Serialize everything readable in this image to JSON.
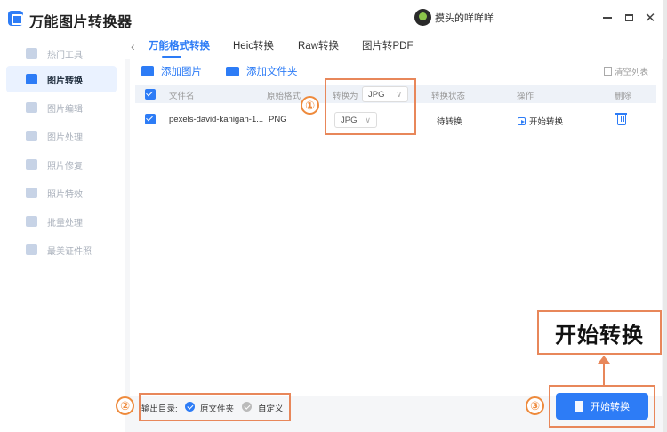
{
  "app": {
    "title": "万能图片转换器",
    "username": "摸头的咩咩咩"
  },
  "sidebar": {
    "items": [
      {
        "label": "热门工具",
        "active": false
      },
      {
        "label": "图片转换",
        "active": true
      },
      {
        "label": "图片编辑",
        "active": false
      },
      {
        "label": "图片处理",
        "active": false
      },
      {
        "label": "照片修复",
        "active": false
      },
      {
        "label": "照片特效",
        "active": false
      },
      {
        "label": "批量处理",
        "active": false
      },
      {
        "label": "最美证件照",
        "active": false
      }
    ]
  },
  "tabs": [
    {
      "label": "万能格式转换",
      "active": true
    },
    {
      "label": "Heic转换",
      "active": false
    },
    {
      "label": "Raw转换",
      "active": false
    },
    {
      "label": "图片转PDF",
      "active": false
    }
  ],
  "toolbar": {
    "add_image": "添加图片",
    "add_folder": "添加文件夹",
    "clear_list": "清空列表"
  },
  "table": {
    "headers": {
      "filename": "文件名",
      "orig_format": "原始格式",
      "convert_to": "转换为",
      "status": "转换状态",
      "action": "操作",
      "delete": "删除"
    },
    "header_convert_value": "JPG",
    "rows": [
      {
        "filename": "pexels-david-kanigan-1...",
        "orig_format": "PNG",
        "convert_to": "JPG",
        "status": "待转换",
        "action": "开始转换"
      }
    ]
  },
  "output": {
    "label": "输出目录:",
    "option_source": "原文件夹",
    "option_custom": "自定义",
    "selected": "原文件夹"
  },
  "start_button": "开始转换",
  "annotations": {
    "n1": "①",
    "n2": "②",
    "n3": "③",
    "callout": "开始转换"
  },
  "colors": {
    "accent": "#2d7cf6",
    "annotation": "#e8875a"
  }
}
